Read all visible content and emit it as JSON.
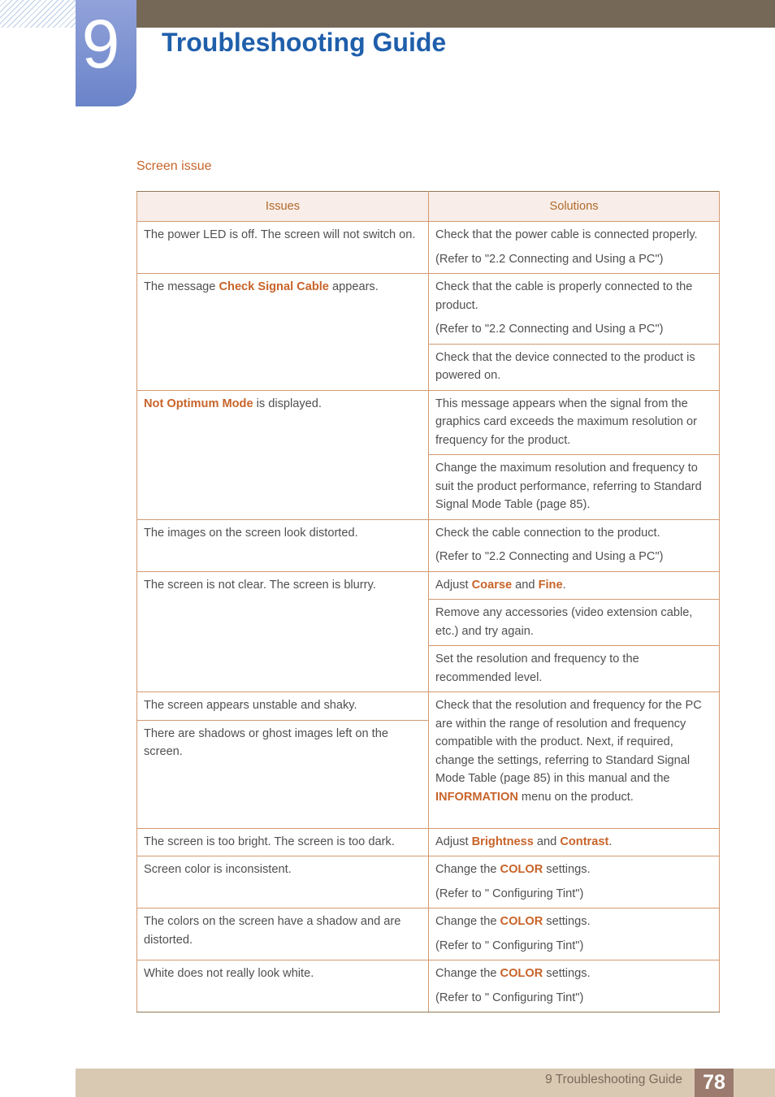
{
  "header": {
    "chapter_number": "9",
    "title": "Troubleshooting Guide"
  },
  "section": {
    "title": "Screen issue"
  },
  "colors": {
    "accent_orange": "#c8642a",
    "title_blue": "#1f5fab",
    "chapter_blue": "#6a84c9",
    "top_bar": "#756857",
    "footer_bar": "#d9c9b3",
    "page_num_bg": "#9a7b6e"
  },
  "table": {
    "headers": {
      "issues": "Issues",
      "solutions": "Solutions"
    },
    "rows": [
      {
        "issue": [
          {
            "t": "The power LED is off. The screen will not switch on."
          }
        ],
        "solutions": [
          [
            [
              {
                "t": "Check that the power cable is connected properly."
              }
            ],
            [
              {
                "t": "(Refer to \"2.2 Connecting and Using a PC\")"
              }
            ]
          ]
        ]
      },
      {
        "issue": [
          {
            "t": "The message "
          },
          {
            "t": "Check Signal Cable",
            "hl": true
          },
          {
            "t": " appears."
          }
        ],
        "solutions": [
          [
            [
              {
                "t": "Check that the cable is properly connected to the product."
              }
            ],
            [
              {
                "t": "(Refer to \"2.2 Connecting and Using a PC\")"
              }
            ]
          ],
          [
            [
              {
                "t": "Check that the device connected to the product is powered on."
              }
            ]
          ]
        ]
      },
      {
        "issue": [
          {
            "t": "Not Optimum Mode",
            "hl": true
          },
          {
            "t": " is displayed."
          }
        ],
        "solutions": [
          [
            [
              {
                "t": "This message appears when the signal from the graphics card exceeds the maximum resolution or frequency for the product."
              }
            ]
          ],
          [
            [
              {
                "t": "Change the maximum resolution and frequency to suit the product performance, referring to Standard Signal Mode Table (page 85)."
              }
            ]
          ]
        ]
      },
      {
        "issue": [
          {
            "t": "The images on the screen look distorted."
          }
        ],
        "solutions": [
          [
            [
              {
                "t": "Check the cable connection to the product."
              }
            ],
            [
              {
                "t": "(Refer to \"2.2 Connecting and Using a PC\")"
              }
            ]
          ]
        ]
      },
      {
        "issue": [
          {
            "t": "The screen is not clear. The screen is blurry."
          }
        ],
        "solutions": [
          [
            [
              {
                "t": "Adjust "
              },
              {
                "t": "Coarse",
                "hl": true
              },
              {
                "t": " and "
              },
              {
                "t": "Fine",
                "hl": true
              },
              {
                "t": "."
              }
            ]
          ],
          [
            [
              {
                "t": "Remove any accessories (video extension cable, etc.) and try again."
              }
            ]
          ],
          [
            [
              {
                "t": "Set the resolution and frequency to the recommended level."
              }
            ]
          ]
        ]
      }
    ],
    "merged_block": {
      "issues": [
        [
          {
            "t": "The screen appears unstable and shaky."
          }
        ],
        [
          {
            "t": "There are shadows or ghost images left on the screen."
          }
        ]
      ],
      "solution": [
        {
          "t": "Check that the resolution and frequency for the PC are within the range of resolution and frequency compatible with the product. Next, if required, change the settings, referring to Standard Signal Mode Table (page 85) in this manual and the "
        },
        {
          "t": "INFORMATION",
          "hl": true
        },
        {
          "t": " menu on the product."
        }
      ]
    },
    "rows_after": [
      {
        "issue": [
          {
            "t": "The screen is too bright. The screen is too dark."
          }
        ],
        "solutions": [
          [
            [
              {
                "t": "Adjust "
              },
              {
                "t": "Brightness",
                "hl": true
              },
              {
                "t": " and "
              },
              {
                "t": "Contrast",
                "hl": true
              },
              {
                "t": "."
              }
            ]
          ]
        ]
      },
      {
        "issue": [
          {
            "t": "Screen color is inconsistent."
          }
        ],
        "solutions": [
          [
            [
              {
                "t": "Change the "
              },
              {
                "t": "COLOR",
                "hl": true
              },
              {
                "t": " settings."
              }
            ],
            [
              {
                "t": "(Refer to \" Configuring Tint\")"
              }
            ]
          ]
        ]
      },
      {
        "issue": [
          {
            "t": "The colors on the screen have a shadow and are distorted."
          }
        ],
        "solutions": [
          [
            [
              {
                "t": "Change the "
              },
              {
                "t": "COLOR",
                "hl": true
              },
              {
                "t": " settings."
              }
            ],
            [
              {
                "t": "(Refer to \" Configuring Tint\")"
              }
            ]
          ]
        ]
      },
      {
        "issue": [
          {
            "t": "White does not really look white."
          }
        ],
        "solutions": [
          [
            [
              {
                "t": "Change the "
              },
              {
                "t": "COLOR",
                "hl": true
              },
              {
                "t": " settings."
              }
            ],
            [
              {
                "t": "(Refer to \" Configuring Tint\")"
              }
            ]
          ]
        ]
      }
    ]
  },
  "footer": {
    "chapter_label": "9 Troubleshooting Guide",
    "page_number": "78"
  }
}
